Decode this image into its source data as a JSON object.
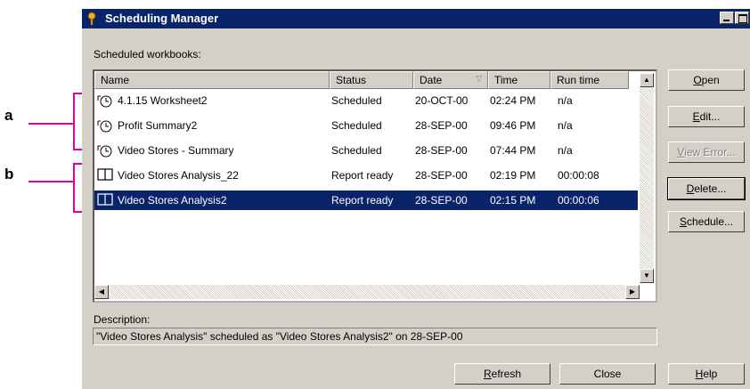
{
  "annotations": [
    {
      "label": "a"
    },
    {
      "label": "b"
    }
  ],
  "window": {
    "title": "Scheduling Manager",
    "section_label": "Scheduled workbooks:",
    "columns": [
      "Name",
      "Status",
      "Date",
      "Time",
      "Run time"
    ],
    "rows": [
      {
        "name": "4.1.15 Worksheet2",
        "status": "Scheduled",
        "date": "20-OCT-00",
        "time": "02:24 PM",
        "runtime": "n/a",
        "icon": "clock-schedule-icon"
      },
      {
        "name": "Profit Summary2",
        "status": "Scheduled",
        "date": "28-SEP-00",
        "time": "09:46 PM",
        "runtime": "n/a",
        "icon": "clock-schedule-icon"
      },
      {
        "name": "Video Stores - Summary",
        "status": "Scheduled",
        "date": "28-SEP-00",
        "time": "07:44 PM",
        "runtime": "n/a",
        "icon": "clock-schedule-icon"
      },
      {
        "name": "Video Stores Analysis_22",
        "status": "Report ready",
        "date": "28-SEP-00",
        "time": "02:19 PM",
        "runtime": "00:00:08",
        "icon": "book-icon"
      },
      {
        "name": "Video Stores Analysis2",
        "status": "Report ready",
        "date": "28-SEP-00",
        "time": "02:15 PM",
        "runtime": "00:00:06",
        "icon": "book-icon",
        "selected": true
      }
    ],
    "side_buttons": {
      "open": {
        "pre": "",
        "key": "O",
        "post": "pen"
      },
      "edit": {
        "pre": "",
        "key": "E",
        "post": "dit..."
      },
      "view_error": {
        "pre": "",
        "key": "V",
        "post": "iew Error..."
      },
      "delete": {
        "pre": "",
        "key": "D",
        "post": "elete..."
      },
      "schedule": {
        "pre": "",
        "key": "S",
        "post": "chedule..."
      }
    },
    "description_label": "Description:",
    "description_text": "\"Video Stores Analysis\" scheduled as \"Video Stores Analysis2\" on 28-SEP-00",
    "bottom_buttons": {
      "refresh": {
        "pre": "",
        "key": "R",
        "post": "efresh"
      },
      "close": {
        "label": "Close"
      },
      "help": {
        "pre": "",
        "key": "H",
        "post": "elp"
      }
    },
    "colors": {
      "titlebar": "#0a246a",
      "selection": "#0a246a",
      "face": "#d4d0c8",
      "annotation": "#e000a0"
    }
  }
}
